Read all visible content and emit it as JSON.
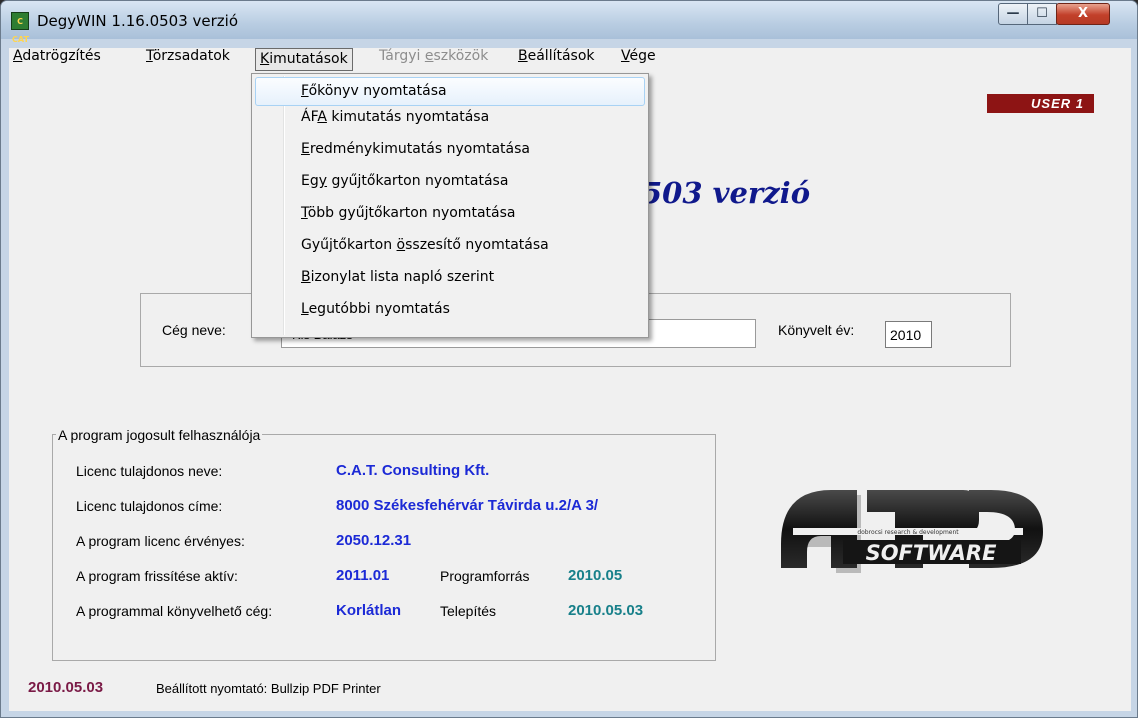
{
  "window": {
    "title": "DegyWIN 1.16.0503 verzió",
    "icon_text": "C CAT",
    "controls": {
      "minimize": "—",
      "maximize": "☐",
      "close": "X"
    }
  },
  "menubar": [
    {
      "label": "Adatrögzítés",
      "accel_index": 0,
      "state": "normal"
    },
    {
      "label": "Törzsadatok",
      "accel_index": 0,
      "state": "normal"
    },
    {
      "label": "Kimutatások",
      "accel_index": 0,
      "state": "active"
    },
    {
      "label": "Tárgyi eszközök",
      "accel_index": 7,
      "state": "disabled"
    },
    {
      "label": "Beállítások",
      "accel_index": 0,
      "state": "normal"
    },
    {
      "label": "Vége",
      "accel_index": 0,
      "state": "normal"
    }
  ],
  "dropdown": {
    "items": [
      {
        "label": "Főkönyv nyomtatása",
        "accel": "F",
        "highlighted": true
      },
      {
        "label": "ÁFA kimutatás nyomtatása",
        "accel": "A",
        "highlighted": false
      },
      {
        "label": "Eredménykimutatás nyomtatása",
        "accel": "E",
        "highlighted": false
      },
      {
        "label": "Egy gyűjtőkarton nyomtatása",
        "accel": "gy",
        "highlighted": false
      },
      {
        "label": "Több gyűjtőkarton nyomtatása",
        "accel": "T",
        "highlighted": false
      },
      {
        "label": "Gyűjtőkarton összesítő nyomtatása",
        "accel": "ö",
        "highlighted": false
      },
      {
        "label": "Bizonylat lista napló szerint",
        "accel": "B",
        "highlighted": false
      },
      {
        "label": "Legutóbbi nyomtatás",
        "accel": "L",
        "highlighted": false
      }
    ]
  },
  "user_badge": "USER 1",
  "version_banner": "503 verzió",
  "company": {
    "label": "Cég neve:",
    "value": "Kis Balázs",
    "year_label": "Könyvelt év:",
    "year_value": "2010"
  },
  "license": {
    "legend": "A program jogosult felhasználója",
    "owner_name_label": "Licenc tulajdonos neve:",
    "owner_name": "C.A.T. Consulting Kft.",
    "owner_address_label": "Licenc tulajdonos címe:",
    "owner_address": "8000 Székesfehérvár Távirda u.2/A 3/",
    "valid_label": "A program licenc érvényes:",
    "valid_until": "2050.12.31",
    "update_label": "A program frissítése aktív:",
    "update_value": "2011.01",
    "source_label": "Programforrás",
    "source_value": "2010.05",
    "companies_label": "A programmal könyvelhető cég:",
    "companies_value": "Korlátlan",
    "install_label": "Telepítés",
    "install_value": "2010.05.03"
  },
  "logo": {
    "letters": "ARD",
    "tagline": "dobrocsi research & development",
    "word": "SOFTWARE"
  },
  "status": {
    "date": "2010.05.03",
    "printer": "Beállított nyomtató: Bullzip PDF Printer"
  },
  "colors": {
    "user_badge": "#8d1414",
    "banner": "#10198c",
    "license_value": "#1c2ad6",
    "license_value2": "#18808a",
    "status_date": "#7a1a46"
  }
}
